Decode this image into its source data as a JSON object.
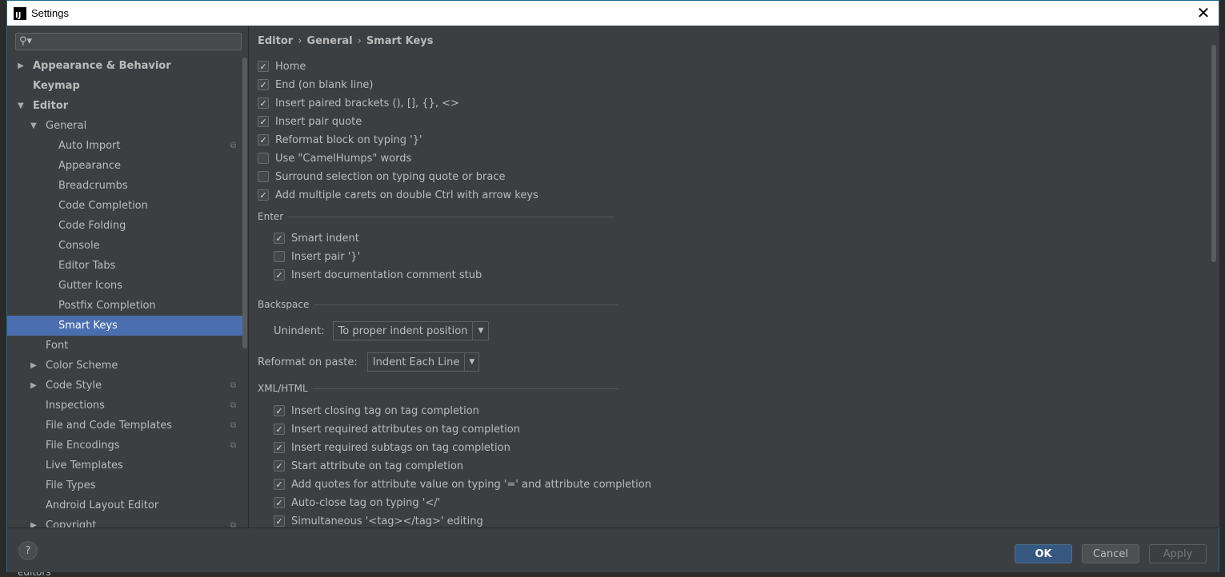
{
  "window": {
    "title": "Settings",
    "app_icon": "IJ"
  },
  "background": {
    "bottom_text": "editors"
  },
  "sidebar": {
    "search_placeholder": "",
    "items": [
      {
        "label": "Appearance & Behavior",
        "level": 0,
        "arrow": "▶",
        "bold": true
      },
      {
        "label": "Keymap",
        "level": 0,
        "arrow": "",
        "bold": true
      },
      {
        "label": "Editor",
        "level": 0,
        "arrow": "▼",
        "bold": true
      },
      {
        "label": "General",
        "level": 1,
        "arrow": "▼"
      },
      {
        "label": "Auto Import",
        "level": 2,
        "project_icon": true
      },
      {
        "label": "Appearance",
        "level": 2
      },
      {
        "label": "Breadcrumbs",
        "level": 2
      },
      {
        "label": "Code Completion",
        "level": 2
      },
      {
        "label": "Code Folding",
        "level": 2
      },
      {
        "label": "Console",
        "level": 2
      },
      {
        "label": "Editor Tabs",
        "level": 2
      },
      {
        "label": "Gutter Icons",
        "level": 2
      },
      {
        "label": "Postfix Completion",
        "level": 2
      },
      {
        "label": "Smart Keys",
        "level": 2,
        "selected": true
      },
      {
        "label": "Font",
        "level": 1
      },
      {
        "label": "Color Scheme",
        "level": 1,
        "arrow": "▶"
      },
      {
        "label": "Code Style",
        "level": 1,
        "arrow": "▶",
        "project_icon": true
      },
      {
        "label": "Inspections",
        "level": 1,
        "project_icon": true
      },
      {
        "label": "File and Code Templates",
        "level": 1,
        "project_icon": true
      },
      {
        "label": "File Encodings",
        "level": 1,
        "project_icon": true
      },
      {
        "label": "Live Templates",
        "level": 1
      },
      {
        "label": "File Types",
        "level": 1
      },
      {
        "label": "Android Layout Editor",
        "level": 1
      },
      {
        "label": "Copyright",
        "level": 1,
        "arrow": "▶",
        "project_icon": true
      }
    ]
  },
  "breadcrumb": [
    "Editor",
    "General",
    "Smart Keys"
  ],
  "breadcrumb_sep": "›",
  "main_options": [
    {
      "label": "Home",
      "checked": true
    },
    {
      "label": "End (on blank line)",
      "checked": true
    },
    {
      "label": "Insert paired brackets (), [], {}, <>",
      "checked": true
    },
    {
      "label": "Insert pair quote",
      "checked": true
    },
    {
      "label": "Reformat block on typing '}'",
      "checked": true
    },
    {
      "label": "Use \"CamelHumps\" words",
      "checked": false
    },
    {
      "label": "Surround selection on typing quote or brace",
      "checked": false
    },
    {
      "label": "Add multiple carets on double Ctrl with arrow keys",
      "checked": true
    }
  ],
  "enter": {
    "title": "Enter",
    "options": [
      {
        "label": "Smart indent",
        "checked": true
      },
      {
        "label": "Insert pair '}'",
        "checked": false
      },
      {
        "label": "Insert documentation comment stub",
        "checked": true
      }
    ]
  },
  "backspace": {
    "title": "Backspace",
    "unindent_label": "Unindent:",
    "unindent_value": "To proper indent position"
  },
  "reformat": {
    "label": "Reformat on paste:",
    "value": "Indent Each Line"
  },
  "xml": {
    "title": "XML/HTML",
    "options": [
      {
        "label": "Insert closing tag on tag completion",
        "checked": true
      },
      {
        "label": "Insert required attributes on tag completion",
        "checked": true
      },
      {
        "label": "Insert required subtags on tag completion",
        "checked": true
      },
      {
        "label": "Start attribute on tag completion",
        "checked": true
      },
      {
        "label": "Add quotes for attribute value on typing '=' and attribute completion",
        "checked": true
      },
      {
        "label": "Auto-close tag on typing '</'",
        "checked": true
      },
      {
        "label": "Simultaneous '<tag></tag>' editing",
        "checked": true
      }
    ]
  },
  "footer": {
    "help": "?",
    "ok": "OK",
    "cancel": "Cancel",
    "apply": "Apply"
  }
}
